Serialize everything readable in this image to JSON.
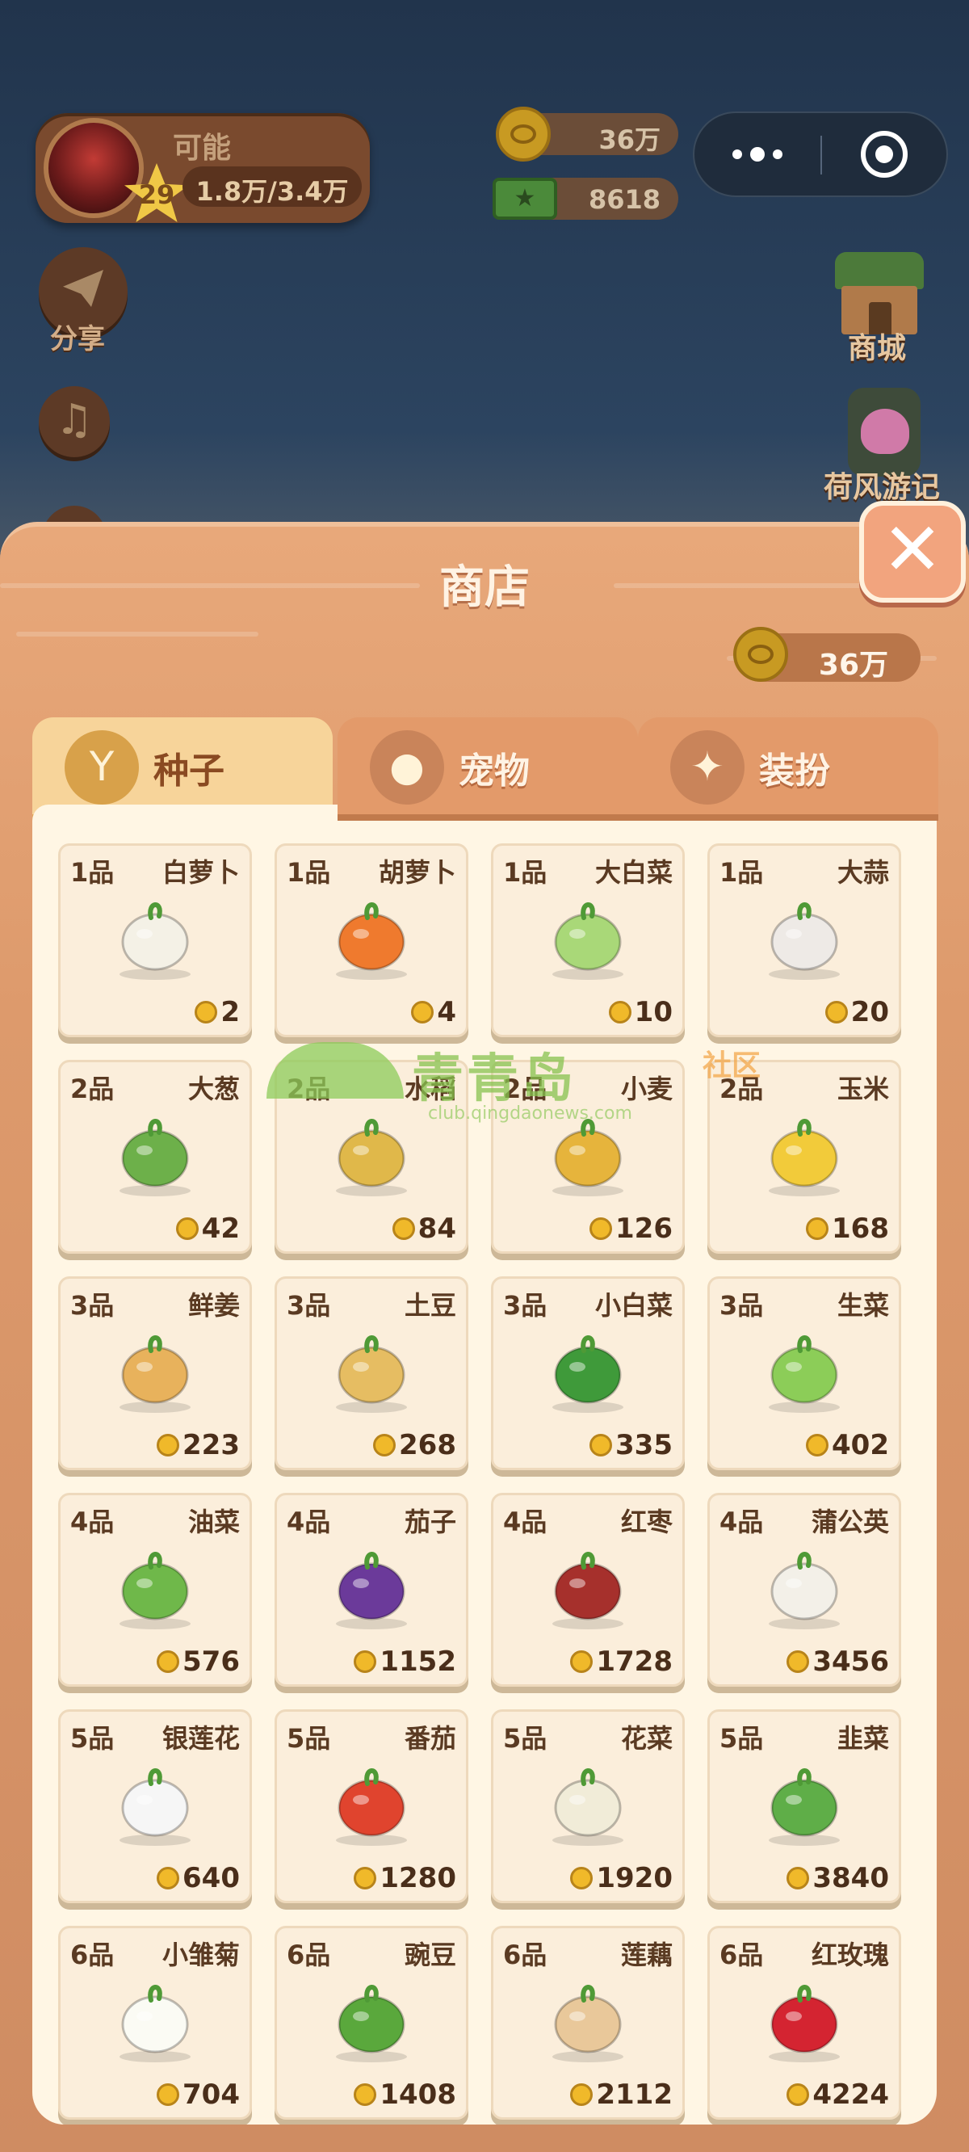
{
  "player": {
    "name": "可能",
    "level": "29",
    "xp": "1.8万/3.4万"
  },
  "wallet": {
    "coins": "36万",
    "cash": "8618"
  },
  "side_buttons": {
    "share": "分享",
    "mall": "商城",
    "lotus": "荷风游记"
  },
  "shop": {
    "title": "商店",
    "coins": "36万",
    "tabs": [
      {
        "label": "种子",
        "icon": "sprout-icon",
        "active": true
      },
      {
        "label": "宠物",
        "icon": "pet-icon",
        "active": false
      },
      {
        "label": "装扮",
        "icon": "sparkle-icon",
        "active": false
      }
    ],
    "items": [
      {
        "grade": "1品",
        "name": "白萝卜",
        "price": "2",
        "icon": "white-radish-icon",
        "color": "#f4f1e6"
      },
      {
        "grade": "1品",
        "name": "胡萝卜",
        "price": "4",
        "icon": "carrot-icon",
        "color": "#ef7a2e"
      },
      {
        "grade": "1品",
        "name": "大白菜",
        "price": "10",
        "icon": "napa-cabbage-icon",
        "color": "#a9d878"
      },
      {
        "grade": "1品",
        "name": "大蒜",
        "price": "20",
        "icon": "garlic-icon",
        "color": "#eeeae6"
      },
      {
        "grade": "2品",
        "name": "大葱",
        "price": "42",
        "icon": "scallion-icon",
        "color": "#6db04a"
      },
      {
        "grade": "2品",
        "name": "水稻",
        "price": "84",
        "icon": "rice-icon",
        "color": "#e0b84a"
      },
      {
        "grade": "2品",
        "name": "小麦",
        "price": "126",
        "icon": "wheat-icon",
        "color": "#e6b43c"
      },
      {
        "grade": "2品",
        "name": "玉米",
        "price": "168",
        "icon": "corn-icon",
        "color": "#f2cb3a"
      },
      {
        "grade": "3品",
        "name": "鲜姜",
        "price": "223",
        "icon": "ginger-icon",
        "color": "#e8b25c"
      },
      {
        "grade": "3品",
        "name": "土豆",
        "price": "268",
        "icon": "potato-icon",
        "color": "#e6bd62"
      },
      {
        "grade": "3品",
        "name": "小白菜",
        "price": "335",
        "icon": "bok-choy-icon",
        "color": "#3f9a3a"
      },
      {
        "grade": "3品",
        "name": "生菜",
        "price": "402",
        "icon": "lettuce-icon",
        "color": "#8ccd58"
      },
      {
        "grade": "4品",
        "name": "油菜",
        "price": "576",
        "icon": "rapeseed-icon",
        "color": "#6fb84a"
      },
      {
        "grade": "4品",
        "name": "茄子",
        "price": "1152",
        "icon": "eggplant-icon",
        "color": "#6b3a9a"
      },
      {
        "grade": "4品",
        "name": "红枣",
        "price": "1728",
        "icon": "jujube-icon",
        "color": "#a6302c"
      },
      {
        "grade": "4品",
        "name": "蒲公英",
        "price": "3456",
        "icon": "dandelion-icon",
        "color": "#f3f0e8"
      },
      {
        "grade": "5品",
        "name": "银莲花",
        "price": "640",
        "icon": "anemone-icon",
        "color": "#f6f6f6"
      },
      {
        "grade": "5品",
        "name": "番茄",
        "price": "1280",
        "icon": "tomato-icon",
        "color": "#e0442e"
      },
      {
        "grade": "5品",
        "name": "花菜",
        "price": "1920",
        "icon": "cauliflower-icon",
        "color": "#f1ecd8"
      },
      {
        "grade": "5品",
        "name": "韭菜",
        "price": "3840",
        "icon": "chives-icon",
        "color": "#5fae48"
      },
      {
        "grade": "6品",
        "name": "小雏菊",
        "price": "704",
        "icon": "daisy-icon",
        "color": "#fbfbf4"
      },
      {
        "grade": "6品",
        "name": "豌豆",
        "price": "1408",
        "icon": "pea-icon",
        "color": "#5aa83c"
      },
      {
        "grade": "6品",
        "name": "莲藕",
        "price": "2112",
        "icon": "lotus-root-icon",
        "color": "#e9c89a"
      },
      {
        "grade": "6品",
        "name": "红玫瑰",
        "price": "4224",
        "icon": "rose-icon",
        "color": "#d42431"
      }
    ]
  },
  "watermark": {
    "brand": "青青岛",
    "suffix": "社区",
    "url": "club.qingdaonews.com"
  }
}
